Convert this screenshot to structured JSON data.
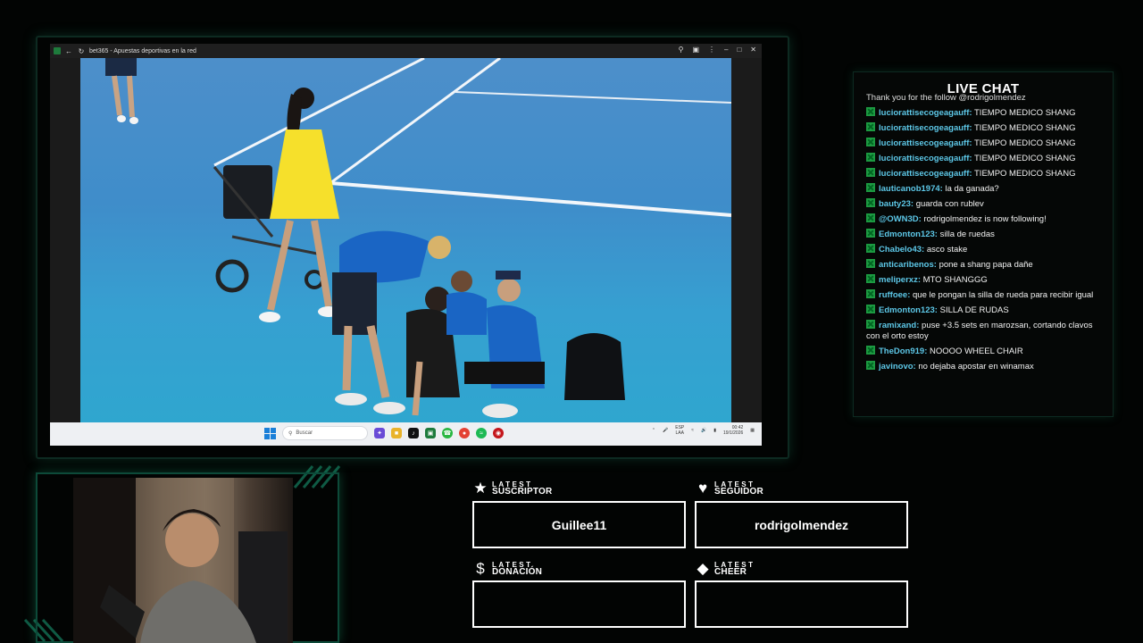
{
  "browser": {
    "title": "bet365 - Apuestas deportivas en la red",
    "icons": [
      "bet365-favicon-icon",
      "back-arrow-icon",
      "reload-icon",
      "search-icon",
      "extensions-icon",
      "more-icon",
      "minimize-icon",
      "maximize-icon",
      "close-icon"
    ]
  },
  "taskbar": {
    "search_placeholder": "Buscar",
    "lang_top": "ESP",
    "lang_bottom": "LAA",
    "time": "00:42",
    "date": "19/1/2026"
  },
  "chat": {
    "title": "LIVE CHAT",
    "partial_line": "Thank you for the follow @rodrigolmendez",
    "messages": [
      {
        "user": "luciorattisecogeagauff:",
        "text": "TIEMPO MEDICO SHANG"
      },
      {
        "user": "luciorattisecogeagauff:",
        "text": "TIEMPO MEDICO SHANG"
      },
      {
        "user": "luciorattisecogeagauff:",
        "text": "TIEMPO MEDICO SHANG"
      },
      {
        "user": "luciorattisecogeagauff:",
        "text": "TIEMPO MEDICO SHANG"
      },
      {
        "user": "luciorattisecogeagauff:",
        "text": "TIEMPO MEDICO SHANG"
      },
      {
        "user": "lauticanob1974:",
        "text": "la da ganada?"
      },
      {
        "user": "bauty23:",
        "text": "guarda con rublev"
      },
      {
        "user": "@OWN3D:",
        "text": "rodrigolmendez is now following!"
      },
      {
        "user": "Edmonton123:",
        "text": "silla de ruedas"
      },
      {
        "user": "Chabelo43:",
        "text": "asco stake"
      },
      {
        "user": "anticaribenos:",
        "text": "pone a shang papa dañe"
      },
      {
        "user": "meliperxz:",
        "text": "MTO SHANGGG"
      },
      {
        "user": "ruffoee:",
        "text": "que le pongan la silla de rueda para recibir igual"
      },
      {
        "user": "Edmonton123:",
        "text": "SILLA DE RUDAS"
      },
      {
        "user": "ramixand:",
        "text": "puse +3.5 sets en marozsan, cortando clavos con el orto estoy"
      },
      {
        "user": "TheDon919:",
        "text": "NOOOO WHEEL CHAIR"
      },
      {
        "user": "javinovo:",
        "text": "no dejaba apostar en winamax"
      }
    ]
  },
  "alerts": {
    "subscriber": {
      "top": "LATEST",
      "bottom": "SUSCRIPTOR",
      "value": "Guillee11",
      "icon": "star-icon"
    },
    "follower": {
      "top": "LATEST",
      "bottom": "SEGUIDOR",
      "value": "rodrigolmendez",
      "icon": "heart-icon"
    },
    "donation": {
      "top": "LATEST",
      "bottom": "DONACIÓN",
      "value": "",
      "icon": "dollar-icon"
    },
    "cheer": {
      "top": "LATEST",
      "bottom": "CHEER",
      "value": "",
      "icon": "diamond-icon"
    }
  },
  "colors": {
    "accent_green": "#1d9b42",
    "chat_username": "#5dc8e8",
    "court_blue": "#3f8dca",
    "frame_glow": "#0d4a39"
  }
}
